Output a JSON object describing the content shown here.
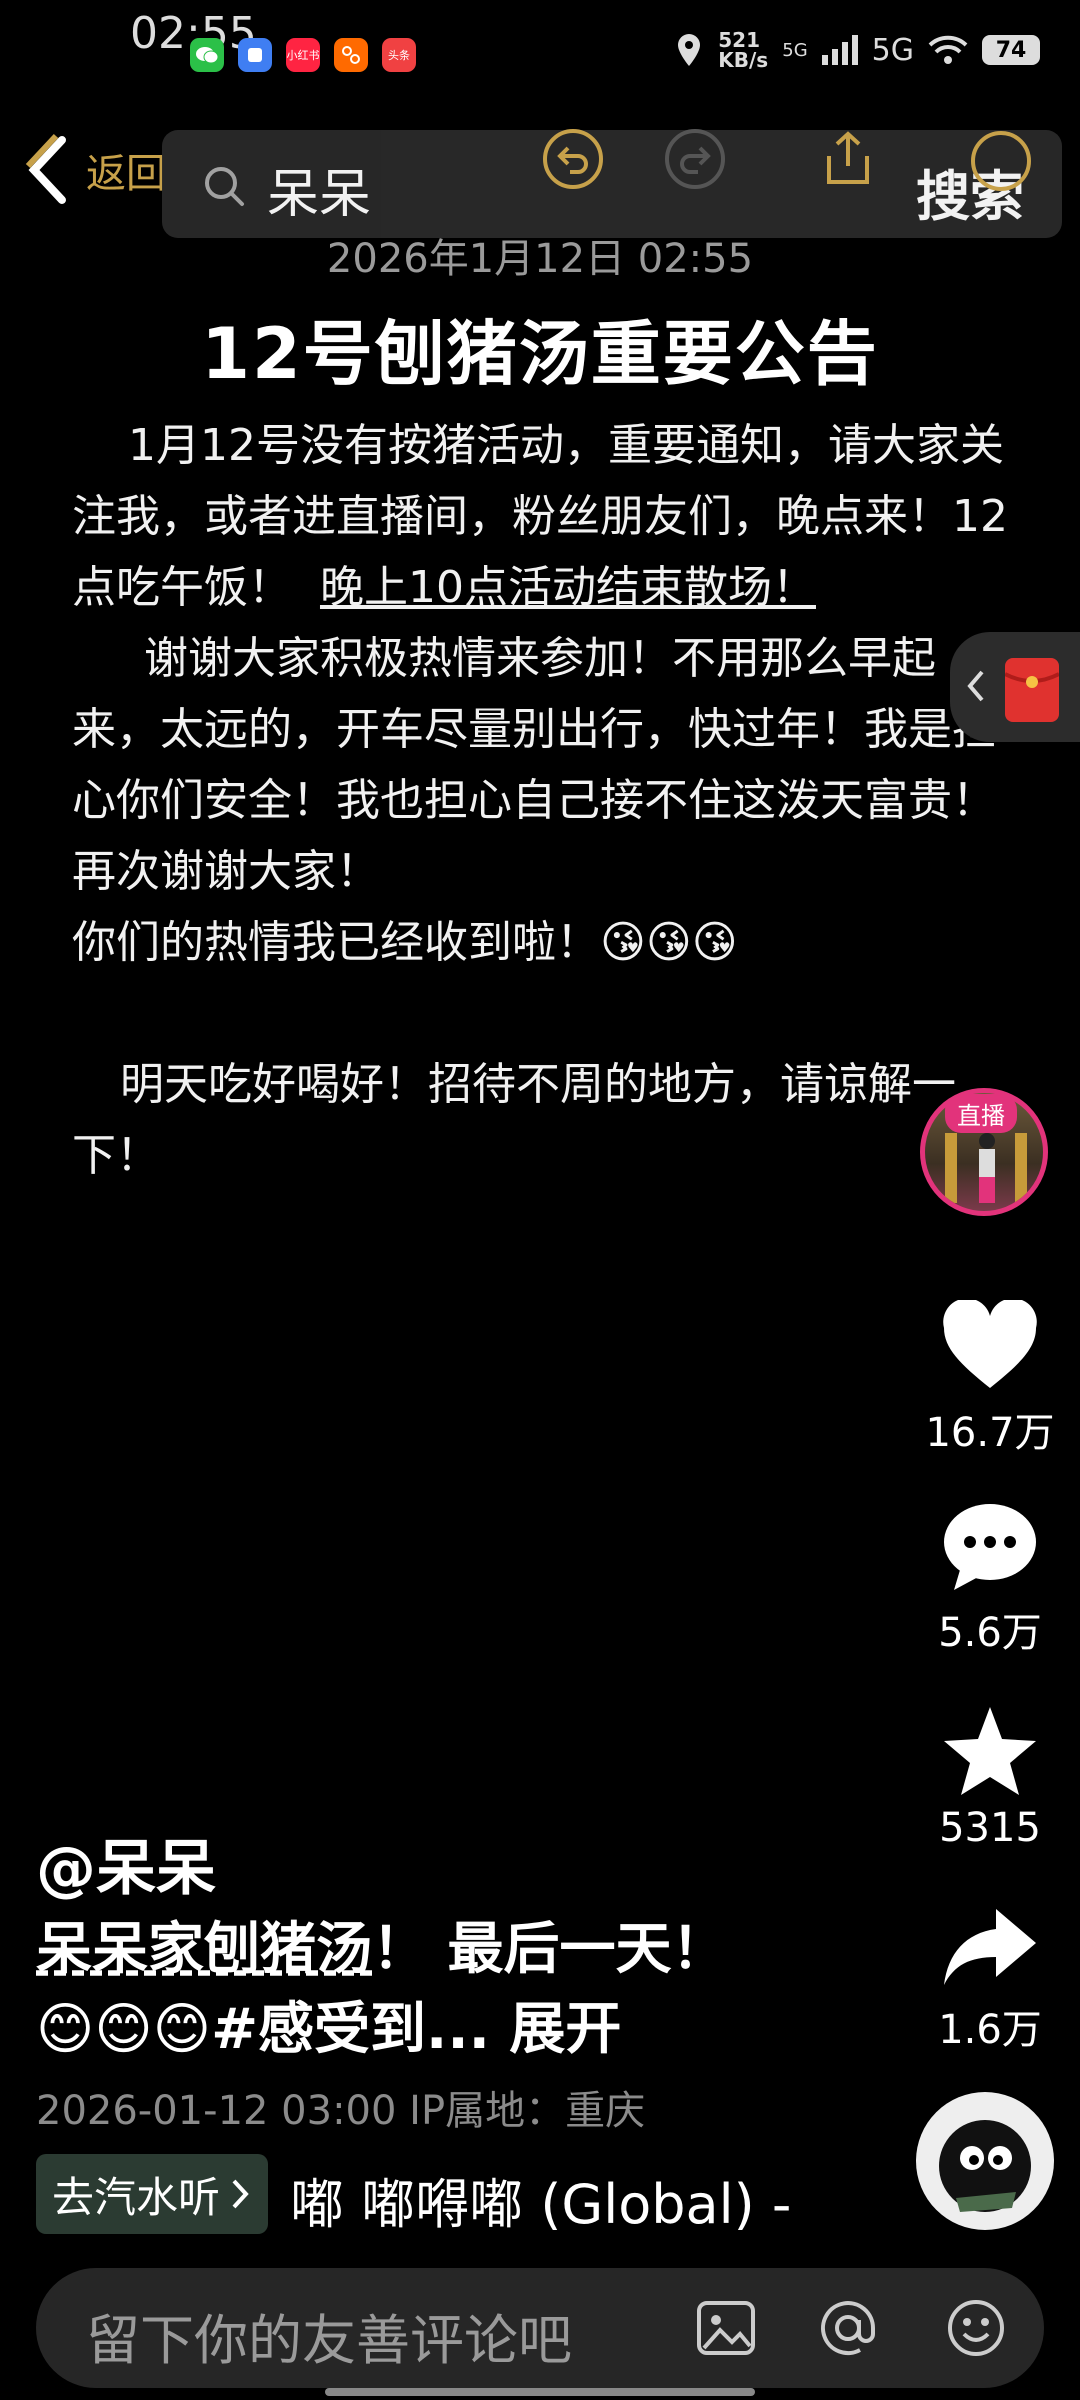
{
  "status_bar": {
    "time": "02:55",
    "net_speed": "521 KB/s",
    "network": "5G",
    "network2": "5G",
    "battery": "74",
    "app_icons": [
      "wechat-icon",
      "generic-app-icon",
      "xiaohongshu-icon",
      "taobao-icon",
      "toutiao-icon"
    ],
    "xhs_label": "小红书",
    "toutiao_label": "头条"
  },
  "nav": {
    "back_label": "返回",
    "search_query": "呆呆",
    "search_button": "搜索"
  },
  "post": {
    "date": "2026年1月12日 02:55",
    "title": "12号刨猪汤重要公告",
    "paragraphs": [
      "1月12号没有按猪活动，重要通知，请大家关注我，或者进直播间，粉丝朋友们，晚点来！12点吃午饭！",
      "晚上10点活动结束散场！",
      "谢谢大家积极热情来参加！不用那么早起来，太远的，开车尽量别出行，快过年！我是担心你们安全！我也担心自己接不住这泼天富贵！再次谢谢大家！",
      "你们的热情我已经收到啦！😘😘😘",
      "明天吃好喝好！招待不周的地方，请谅解一下！"
    ]
  },
  "live": {
    "badge": "直播"
  },
  "actions": {
    "likes": "16.7万",
    "comments": "5.6万",
    "favorites": "5315",
    "shares": "1.6万"
  },
  "video_info": {
    "author": "@呆呆",
    "desc_link": "呆呆家刨猪汤",
    "desc_rest": "！ 最后一天！",
    "desc_line2": "😊😊😊#感受到... ",
    "expand": "展开",
    "meta": "2026-01-12 03:00  IP属地：重庆",
    "music_tag": "去汽水听",
    "music_title": "嘟  嘟嘚嘟 (Global) -"
  },
  "comment": {
    "placeholder": "留下你的友善评论吧"
  },
  "colors": {
    "accent_gold": "#c7a14a",
    "live_pink": "#e2337b",
    "background": "#000000"
  }
}
